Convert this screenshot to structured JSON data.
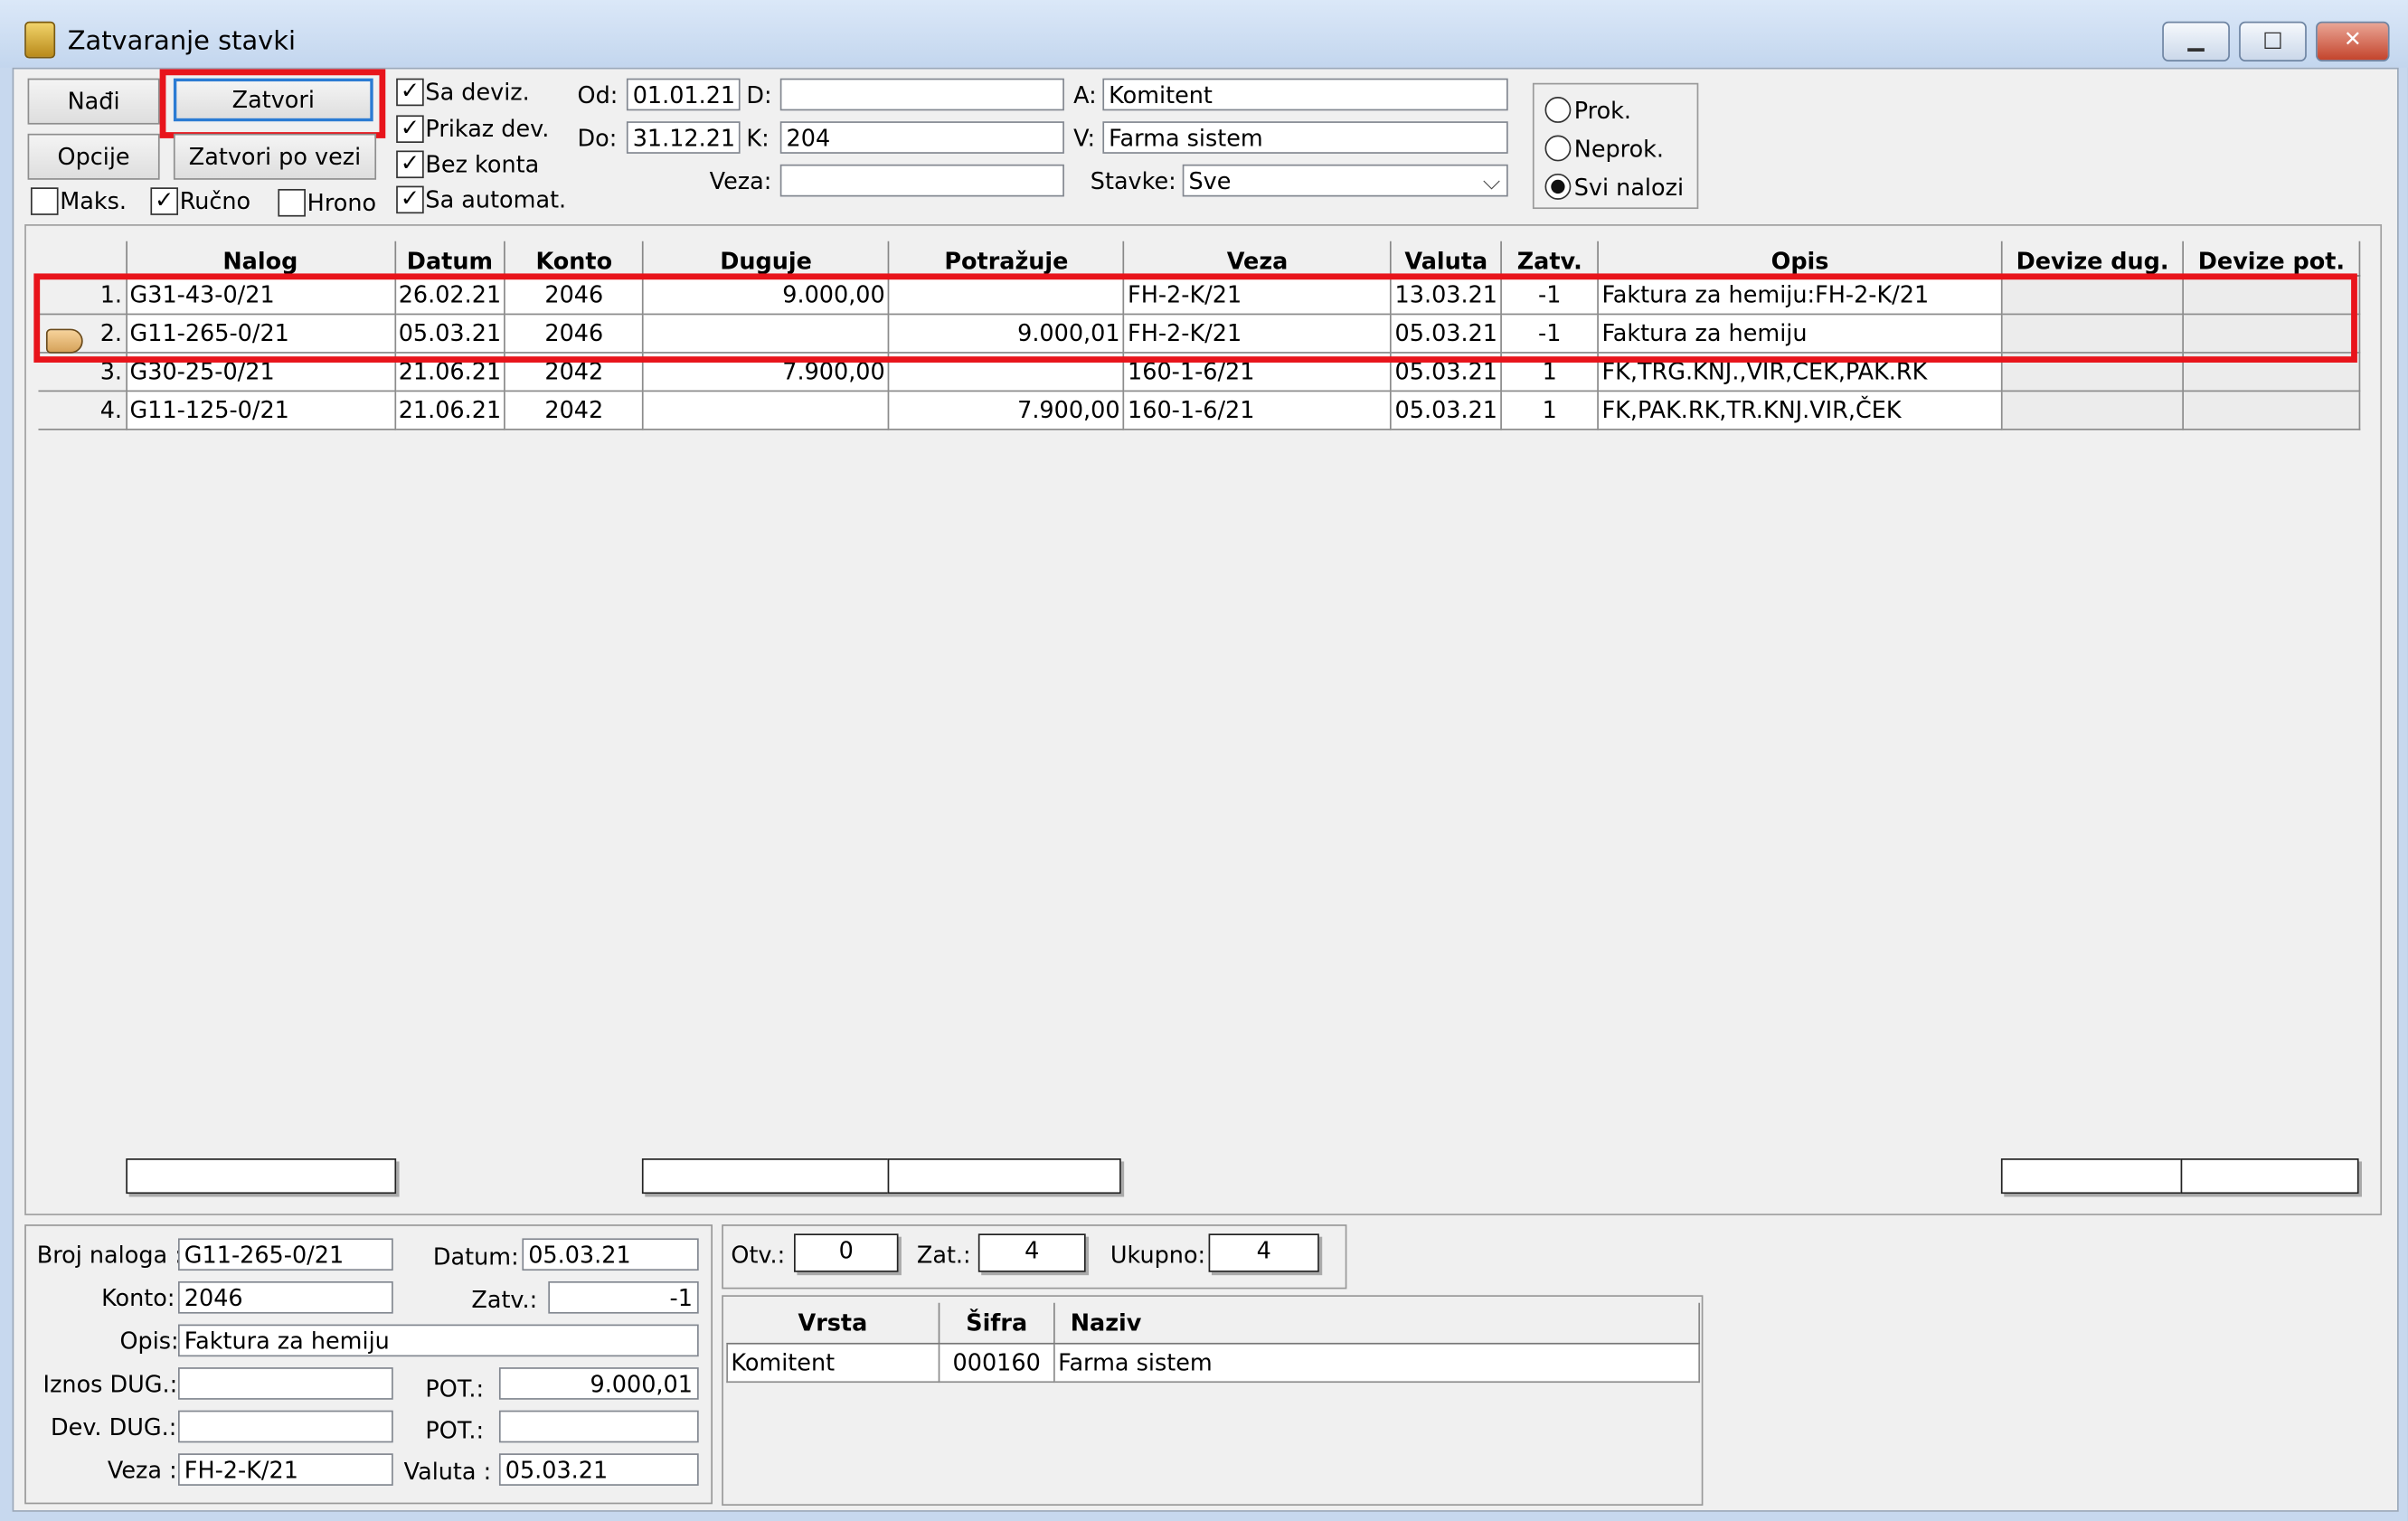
{
  "window": {
    "title": "Zatvaranje stavki"
  },
  "toolbar": {
    "find_label": "Nađi",
    "close_label": "Zatvori",
    "options_label": "Opcije",
    "close_by_link_label": "Zatvori po vezi",
    "max_label": "Maks.",
    "manual_label": "Ručno",
    "chrono_label": "Hrono",
    "checkboxes": {
      "sa_deviz": {
        "label": "Sa deviz.",
        "checked": true
      },
      "prikaz_dev": {
        "label": "Prikaz dev.",
        "checked": true
      },
      "bez_konta": {
        "label": "Bez konta",
        "checked": true
      },
      "sa_automat": {
        "label": "Sa automat.",
        "checked": true
      },
      "maks": {
        "checked": false
      },
      "rucno": {
        "checked": true
      },
      "hrono": {
        "checked": false
      }
    }
  },
  "filters": {
    "od_label": "Od:",
    "od_value": "01.01.21",
    "do_label": "Do:",
    "do_value": "31.12.21",
    "d_label": "D:",
    "d_value": "",
    "k_label": "K:",
    "k_value": "204",
    "veza_label": "Veza:",
    "veza_value": "",
    "a_label": "A:",
    "a_value": "Komitent",
    "v_label": "V:",
    "v_value": "Farma sistem",
    "stavke_label": "Stavke:",
    "stavke_value": "Sve"
  },
  "radio": {
    "prok": "Prok.",
    "neprok": "Neprok.",
    "svi": "Svi nalozi",
    "selected": "svi"
  },
  "grid": {
    "headers": [
      "Nalog",
      "Datum",
      "Konto",
      "Duguje",
      "Potražuje",
      "Veza",
      "Valuta",
      "Zatv.",
      "Opis",
      "Devize dug.",
      "Devize pot."
    ],
    "rows": [
      {
        "n": "1.",
        "nalog": "G31-43-0/21",
        "datum": "26.02.21",
        "konto": "2046",
        "duguje": "9.000,00",
        "potrazuje": "",
        "veza": "FH-2-K/21",
        "valuta": "13.03.21",
        "zatv": "-1",
        "opis": "Faktura za hemiju:FH-2-K/21",
        "dev_dug": "",
        "dev_pot": ""
      },
      {
        "n": "2.",
        "nalog": "G11-265-0/21",
        "datum": "05.03.21",
        "konto": "2046",
        "duguje": "",
        "potrazuje": "9.000,01",
        "veza": "FH-2-K/21",
        "valuta": "05.03.21",
        "zatv": "-1",
        "opis": "Faktura za hemiju",
        "dev_dug": "",
        "dev_pot": ""
      },
      {
        "n": "3.",
        "nalog": "G30-25-0/21",
        "datum": "21.06.21",
        "konto": "2042",
        "duguje": "7.900,00",
        "potrazuje": "",
        "veza": "160-1-6/21",
        "valuta": "05.03.21",
        "zatv": "1",
        "opis": "FK,TRG.KNJ.,VIR,CEK,PAK.RK",
        "dev_dug": "",
        "dev_pot": ""
      },
      {
        "n": "4.",
        "nalog": "G11-125-0/21",
        "datum": "21.06.21",
        "konto": "2042",
        "duguje": "",
        "potrazuje": "7.900,00",
        "veza": "160-1-6/21",
        "valuta": "05.03.21",
        "zatv": "1",
        "opis": "FK,PAK.RK,TR.KNJ.VIR,ČEK",
        "dev_dug": "",
        "dev_pot": ""
      }
    ]
  },
  "details": {
    "broj_naloga_label": "Broj naloga :",
    "broj_naloga": "G11-265-0/21",
    "datum_label": "Datum:",
    "datum": "05.03.21",
    "konto_label": "Konto:",
    "konto": "2046",
    "zatv_label": "Zatv.:",
    "zatv": "-1",
    "opis_label": "Opis:",
    "opis": "Faktura za hemiju",
    "iznos_dug_label": "Iznos DUG.:",
    "iznos_dug": "",
    "pot_label": "POT.:",
    "pot": "9.000,01",
    "dev_dug_label": "Dev. DUG.:",
    "dev_dug": "",
    "dev_pot_label": "POT.:",
    "dev_pot": "",
    "veza_label": "Veza :",
    "veza": "FH-2-K/21",
    "valuta_label": "Valuta :",
    "valuta": "05.03.21"
  },
  "counters": {
    "otv_label": "Otv.:",
    "otv": "0",
    "zat_label": "Zat.:",
    "zat": "4",
    "ukupno_label": "Ukupno:",
    "ukupno": "4"
  },
  "subgrid": {
    "headers": [
      "Vrsta",
      "Šifra",
      "Naziv"
    ],
    "rows": [
      {
        "vrsta": "Komitent",
        "sifra": "000160",
        "naziv": "Farma sistem"
      }
    ]
  },
  "colors": {
    "highlight": "#e8141b",
    "focus_border": "#2b7bd3"
  }
}
